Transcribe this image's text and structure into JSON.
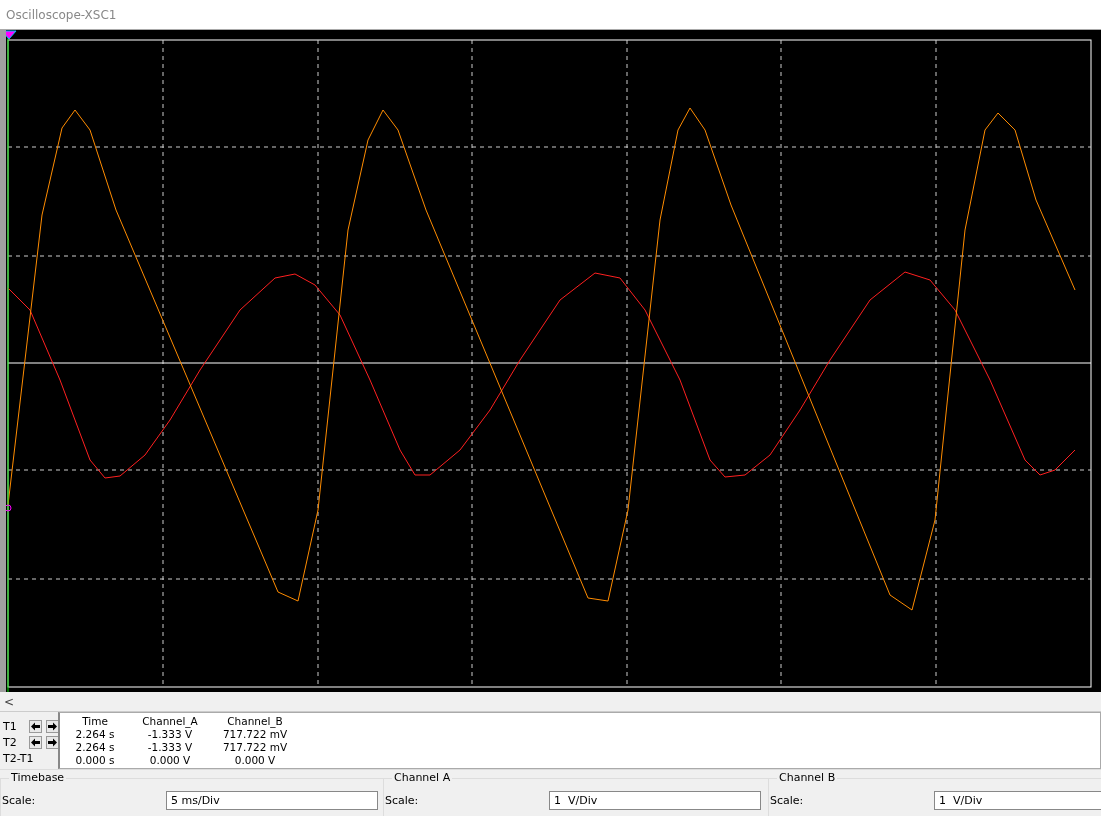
{
  "window": {
    "title": "Oscilloscope-XSC1"
  },
  "scroll_button": "<",
  "readout": {
    "columns": [
      "Time",
      "Channel_A",
      "Channel_B"
    ],
    "rows": [
      {
        "kind": "cursor",
        "label": "T1",
        "values": [
          "2.264 s",
          "-1.333 V",
          "717.722 mV"
        ]
      },
      {
        "kind": "cursor",
        "label": "T2",
        "values": [
          "2.264 s",
          "-1.333 V",
          "717.722 mV"
        ]
      },
      {
        "kind": "difference",
        "label": "T2-T1",
        "values": [
          "0.000 s",
          "0.000 V",
          "0.000 V"
        ]
      }
    ]
  },
  "panels": [
    {
      "title": "Timebase",
      "scale_label": "Scale:",
      "scale_value": "5 ms/Div"
    },
    {
      "title": "Channel A",
      "scale_label": "Scale:",
      "scale_value": "1  V/Div"
    },
    {
      "title": "Channel B",
      "scale_label": "Scale:",
      "scale_value": "1  V/Div"
    }
  ]
}
